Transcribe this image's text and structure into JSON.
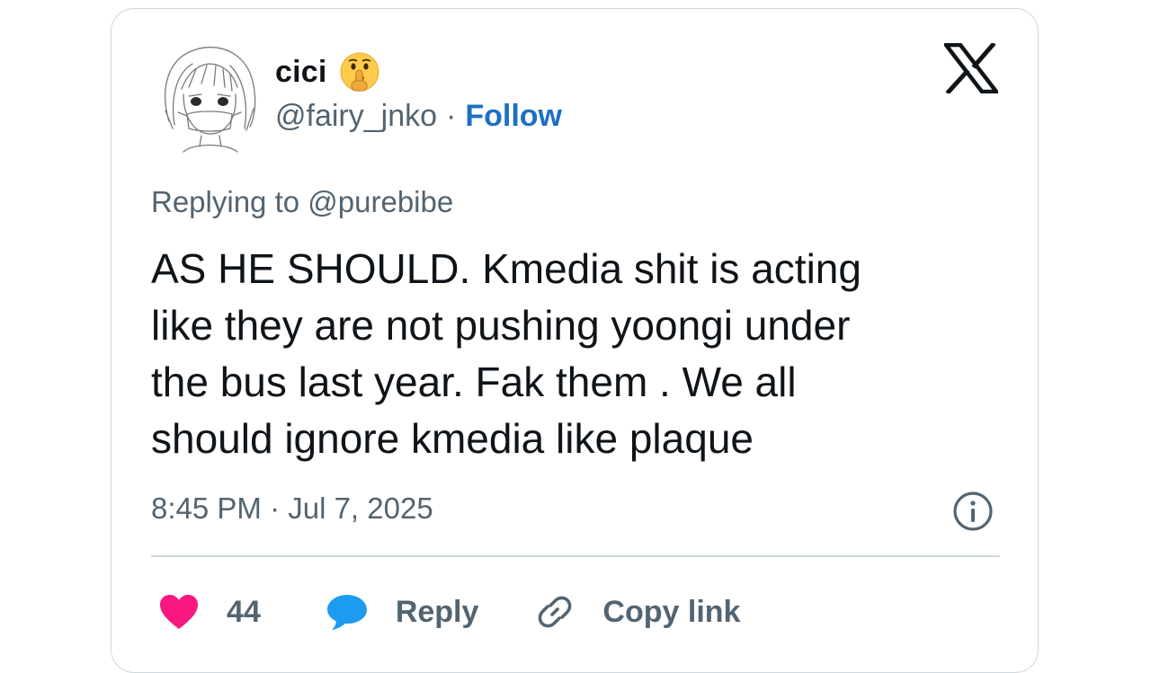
{
  "author": {
    "display_name": "cici",
    "handle": "@fairy_jnko",
    "separator": "·",
    "follow_label": "Follow"
  },
  "tweet": {
    "replying_to": "Replying to @purebibe",
    "text_lines": [
      "AS HE SHOULD. Kmedia shit is acting",
      "like they are not pushing yoongi under",
      "the bus last year. Fak them . We all",
      "should ignore kmedia like plaque"
    ],
    "timestamp": "8:45 PM · Jul 7, 2025"
  },
  "actions": {
    "like_count": "44",
    "reply_label": "Reply",
    "copy_link_label": "Copy link"
  },
  "icons": {
    "emoji": "shushing-face-emoji",
    "brand": "x-logo-icon",
    "info": "info-icon",
    "like": "heart-icon",
    "reply": "speech-bubble-icon",
    "link": "link-icon"
  },
  "colors": {
    "follow": "#1d6fc2",
    "heart": "#f91880",
    "reply_bubble": "#1d9bf0",
    "secondary_text": "#536471",
    "border": "#cfd9de"
  }
}
